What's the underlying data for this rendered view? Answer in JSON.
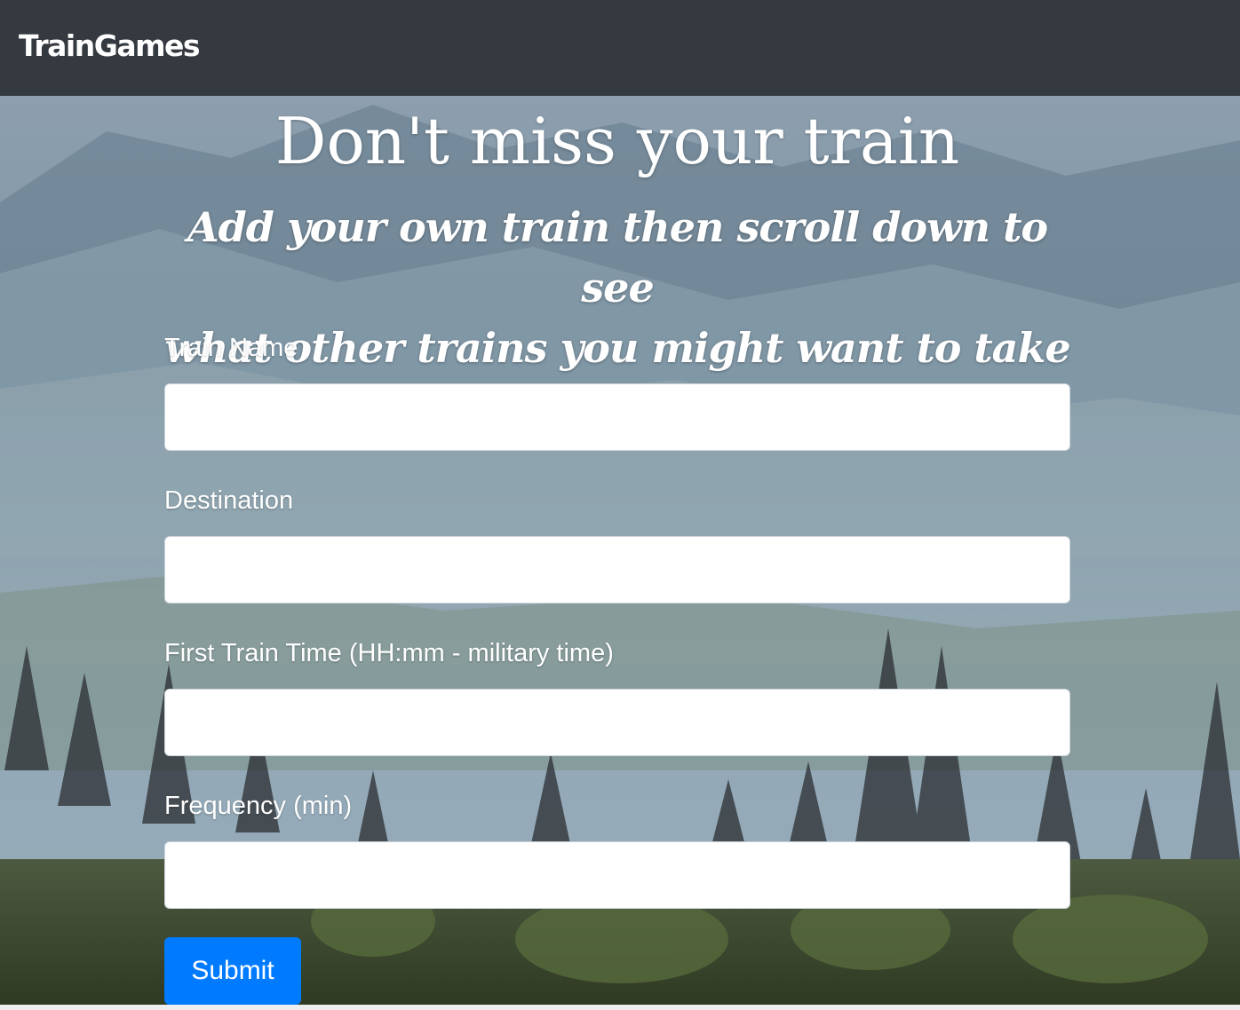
{
  "navbar": {
    "brand": "TrainGames"
  },
  "hero": {
    "title": "Don't miss your train",
    "subtitle_line1": "Add your own train then scroll down to see",
    "subtitle_line2": "what other trains you might want to take"
  },
  "form": {
    "fields": [
      {
        "label": "Train Name",
        "value": ""
      },
      {
        "label": "Destination",
        "value": ""
      },
      {
        "label": "First Train Time (HH:mm - military time)",
        "value": ""
      },
      {
        "label": "Frequency (min)",
        "value": ""
      }
    ],
    "submit_label": "Submit"
  },
  "colors": {
    "navbar_bg": "#343a40",
    "primary": "#007bff",
    "text_on_dark": "#ffffff"
  }
}
